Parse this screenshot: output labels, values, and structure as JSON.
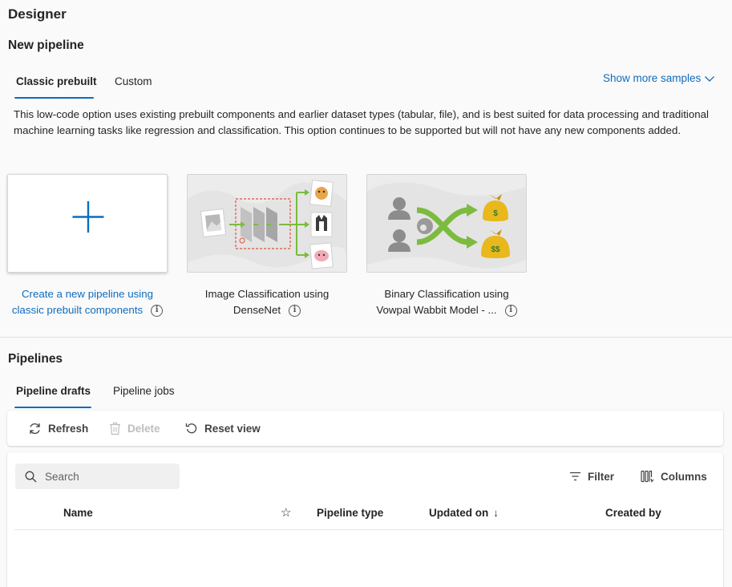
{
  "page": {
    "title": "Designer"
  },
  "new_pipeline": {
    "heading": "New pipeline",
    "tabs": [
      {
        "label": "Classic prebuilt",
        "active": true
      },
      {
        "label": "Custom",
        "active": false
      }
    ],
    "show_more": "Show more samples",
    "description": "This low-code option uses existing prebuilt components and earlier dataset types (tabular, file), and is best suited for data processing and traditional machine learning tasks like regression and classification. This option continues to be supported but will not have any new components added.",
    "cards": [
      {
        "line1": "Create a new pipeline using",
        "line2": "classic prebuilt components",
        "icon": "plus-icon"
      },
      {
        "line1": "Image Classification using",
        "line2": "DenseNet",
        "icon": "image-classification-thumbnail"
      },
      {
        "line1": "Binary Classification using",
        "line2": "Vowpal Wabbit Model - ...",
        "icon": "binary-classification-thumbnail"
      }
    ],
    "info_glyph": "i"
  },
  "pipelines": {
    "heading": "Pipelines",
    "tabs": [
      {
        "label": "Pipeline drafts",
        "active": true
      },
      {
        "label": "Pipeline jobs",
        "active": false
      }
    ],
    "toolbar": {
      "refresh": "Refresh",
      "delete": "Delete",
      "reset_view": "Reset view"
    },
    "search_placeholder": "Search",
    "filter": "Filter",
    "columns": "Columns",
    "table_headers": {
      "name": "Name",
      "favorite": "☆",
      "pipeline_type": "Pipeline type",
      "updated_on": "Updated on",
      "sort_indicator": "↓",
      "created_by": "Created by"
    },
    "rows": []
  },
  "colors": {
    "accent": "#0f6cbd",
    "background": "#fafafa",
    "card_image_bg": "#e4e4e4",
    "arrow_green": "#7cbb3f",
    "money_gold": "#e8b81c"
  }
}
